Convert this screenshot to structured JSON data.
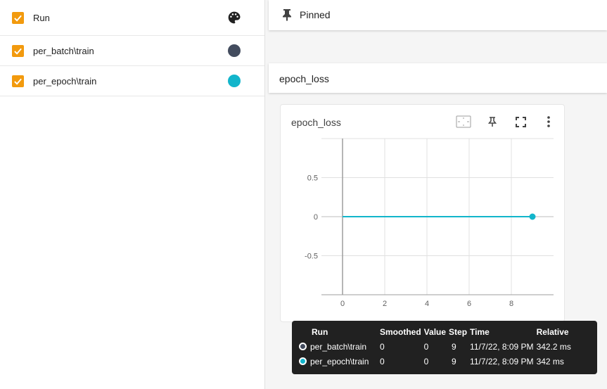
{
  "runs": {
    "header_label": "Run",
    "items": [
      {
        "label": "per_batch\\train",
        "color": "#434c5e"
      },
      {
        "label": "per_epoch\\train",
        "color": "#12b5cb"
      }
    ]
  },
  "pinned": {
    "title": "Pinned"
  },
  "group": {
    "title": "epoch_loss"
  },
  "card": {
    "title": "epoch_loss"
  },
  "chart_data": {
    "type": "line",
    "title": "epoch_loss",
    "xlabel": "",
    "ylabel": "",
    "x_ticks": [
      "0",
      "2",
      "4",
      "6",
      "8"
    ],
    "y_ticks": [
      "0.5",
      "0",
      "-0.5"
    ],
    "xlim": [
      -1,
      10
    ],
    "ylim": [
      -1,
      1
    ],
    "grid": true,
    "series": [
      {
        "name": "per_batch\\train",
        "color": "#434c5e",
        "x": [
          0,
          1,
          2,
          3,
          4,
          5,
          6,
          7,
          8,
          9
        ],
        "y": [
          0,
          0,
          0,
          0,
          0,
          0,
          0,
          0,
          0,
          0
        ]
      },
      {
        "name": "per_epoch\\train",
        "color": "#12b5cb",
        "x": [
          0,
          1,
          2,
          3,
          4,
          5,
          6,
          7,
          8,
          9
        ],
        "y": [
          0,
          0,
          0,
          0,
          0,
          0,
          0,
          0,
          0,
          0
        ]
      }
    ],
    "highlight_x": 9
  },
  "tooltip": {
    "headers": [
      "Run",
      "Smoothed",
      "Value",
      "Step",
      "Time",
      "Relative"
    ],
    "rows": [
      {
        "color": "#434c5e",
        "run": "per_batch\\train",
        "smoothed": "0",
        "value": "0",
        "step": "9",
        "time": "11/7/22, 8:09 PM",
        "relative": "342.2 ms"
      },
      {
        "color": "#12b5cb",
        "run": "per_epoch\\train",
        "smoothed": "0",
        "value": "0",
        "step": "9",
        "time": "11/7/22, 8:09 PM",
        "relative": "342 ms"
      }
    ]
  }
}
